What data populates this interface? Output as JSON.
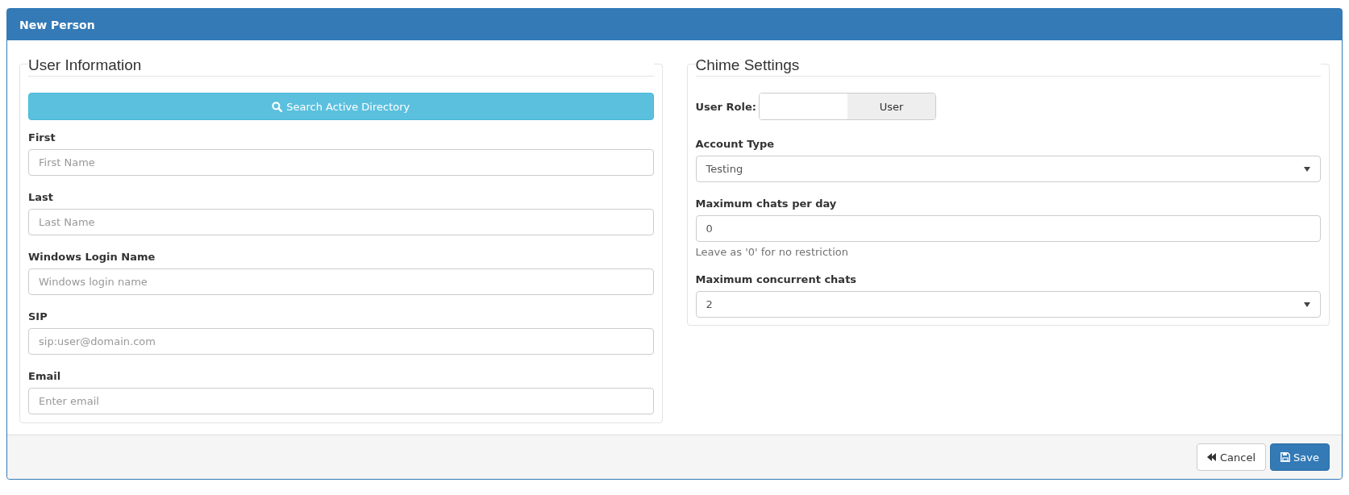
{
  "window": {
    "title": "New Person"
  },
  "user_information": {
    "title": "User Information",
    "search_button": "Search Active Directory",
    "fields": [
      {
        "label": "First",
        "placeholder": "First Name"
      },
      {
        "label": "Last",
        "placeholder": "Last Name"
      },
      {
        "label": "Windows Login Name",
        "placeholder": "Windows login name"
      },
      {
        "label": "SIP",
        "placeholder": "sip:user@domain.com"
      },
      {
        "label": "Email",
        "placeholder": "Enter email"
      }
    ]
  },
  "chime_settings": {
    "title": "Chime Settings",
    "user_role": {
      "label": "User Role:",
      "value": "User"
    },
    "fields": [
      {
        "kind": "select",
        "label": "Account Type",
        "value": "Testing"
      },
      {
        "kind": "input",
        "label": "Maximum chats per day",
        "value": "0",
        "help": "Leave as '0' for no restriction"
      },
      {
        "kind": "select",
        "label": "Maximum concurrent chats",
        "value": "2"
      }
    ]
  },
  "footer": {
    "buttons": [
      {
        "kind": "cancel",
        "label": "Cancel"
      },
      {
        "kind": "save",
        "label": "Save"
      }
    ]
  }
}
